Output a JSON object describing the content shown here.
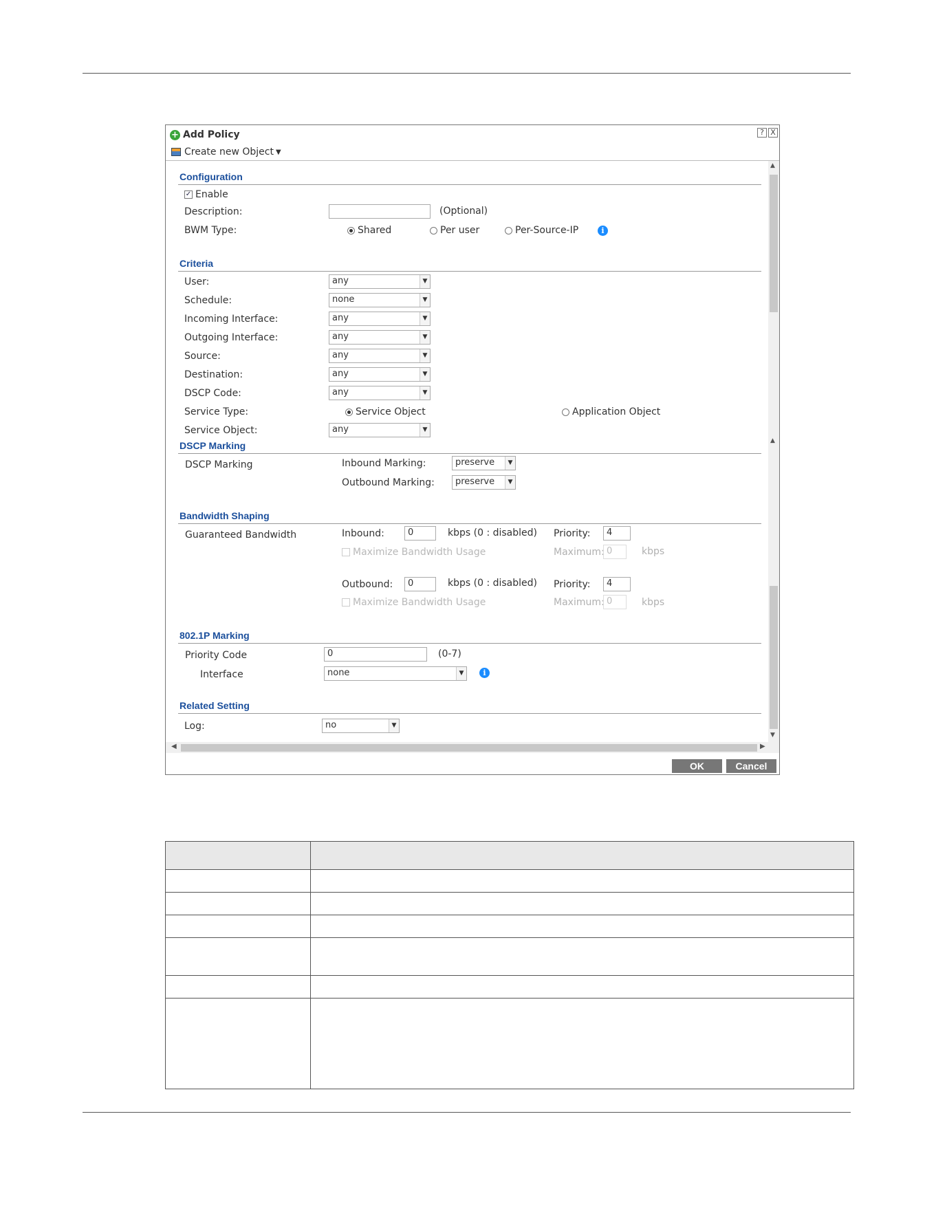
{
  "dialog": {
    "title": "Add Policy",
    "help_btn": "?",
    "close_btn": "X",
    "toolbar": {
      "create_label": "Create new Object",
      "caret": "▼"
    }
  },
  "configuration": {
    "title": "Configuration",
    "enable_label": "Enable",
    "enable_checked": true,
    "description_label": "Description:",
    "description_value": "",
    "optional_label": "(Optional)",
    "bwm_type_label": "BWM Type:",
    "bwm_options": [
      "Shared",
      "Per user",
      "Per-Source-IP"
    ],
    "bwm_selected": "Shared"
  },
  "criteria": {
    "title": "Criteria",
    "user_label": "User:",
    "user_value": "any",
    "schedule_label": "Schedule:",
    "schedule_value": "none",
    "incoming_label": "Incoming Interface:",
    "incoming_value": "any",
    "outgoing_label": "Outgoing Interface:",
    "outgoing_value": "any",
    "source_label": "Source:",
    "source_value": "any",
    "destination_label": "Destination:",
    "destination_value": "any",
    "dscp_label": "DSCP Code:",
    "dscp_value": "any",
    "service_type_label": "Service Type:",
    "service_type_options": [
      "Service Object",
      "Application Object"
    ],
    "service_type_selected": "Service Object",
    "service_object_label": "Service Object:",
    "service_object_value": "any"
  },
  "dscp_marking": {
    "title": "DSCP Marking",
    "row_label": "DSCP Marking",
    "inbound_label": "Inbound Marking:",
    "inbound_value": "preserve",
    "outbound_label": "Outbound Marking:",
    "outbound_value": "preserve"
  },
  "bandwidth": {
    "title": "Bandwidth Shaping",
    "row_label": "Guaranteed Bandwidth",
    "inbound_label": "Inbound:",
    "inbound_value": "0",
    "kbps_disabled": "kbps (0 : disabled)",
    "priority_label": "Priority:",
    "inbound_priority": "4",
    "maximize_label": "Maximize Bandwidth Usage",
    "maximum_label": "Maximum:",
    "inbound_max": "0",
    "kbps": "kbps",
    "outbound_label": "Outbound:",
    "outbound_value": "0",
    "outbound_priority": "4",
    "outbound_max": "0"
  },
  "marking_8021p": {
    "title": "802.1P Marking",
    "priority_label": "Priority Code",
    "priority_value": "0",
    "range": "(0-7)",
    "interface_label": "Interface",
    "interface_value": "none"
  },
  "related": {
    "title": "Related Setting",
    "log_label": "Log:",
    "log_value": "no"
  },
  "buttons": {
    "ok": "OK",
    "cancel": "Cancel"
  }
}
